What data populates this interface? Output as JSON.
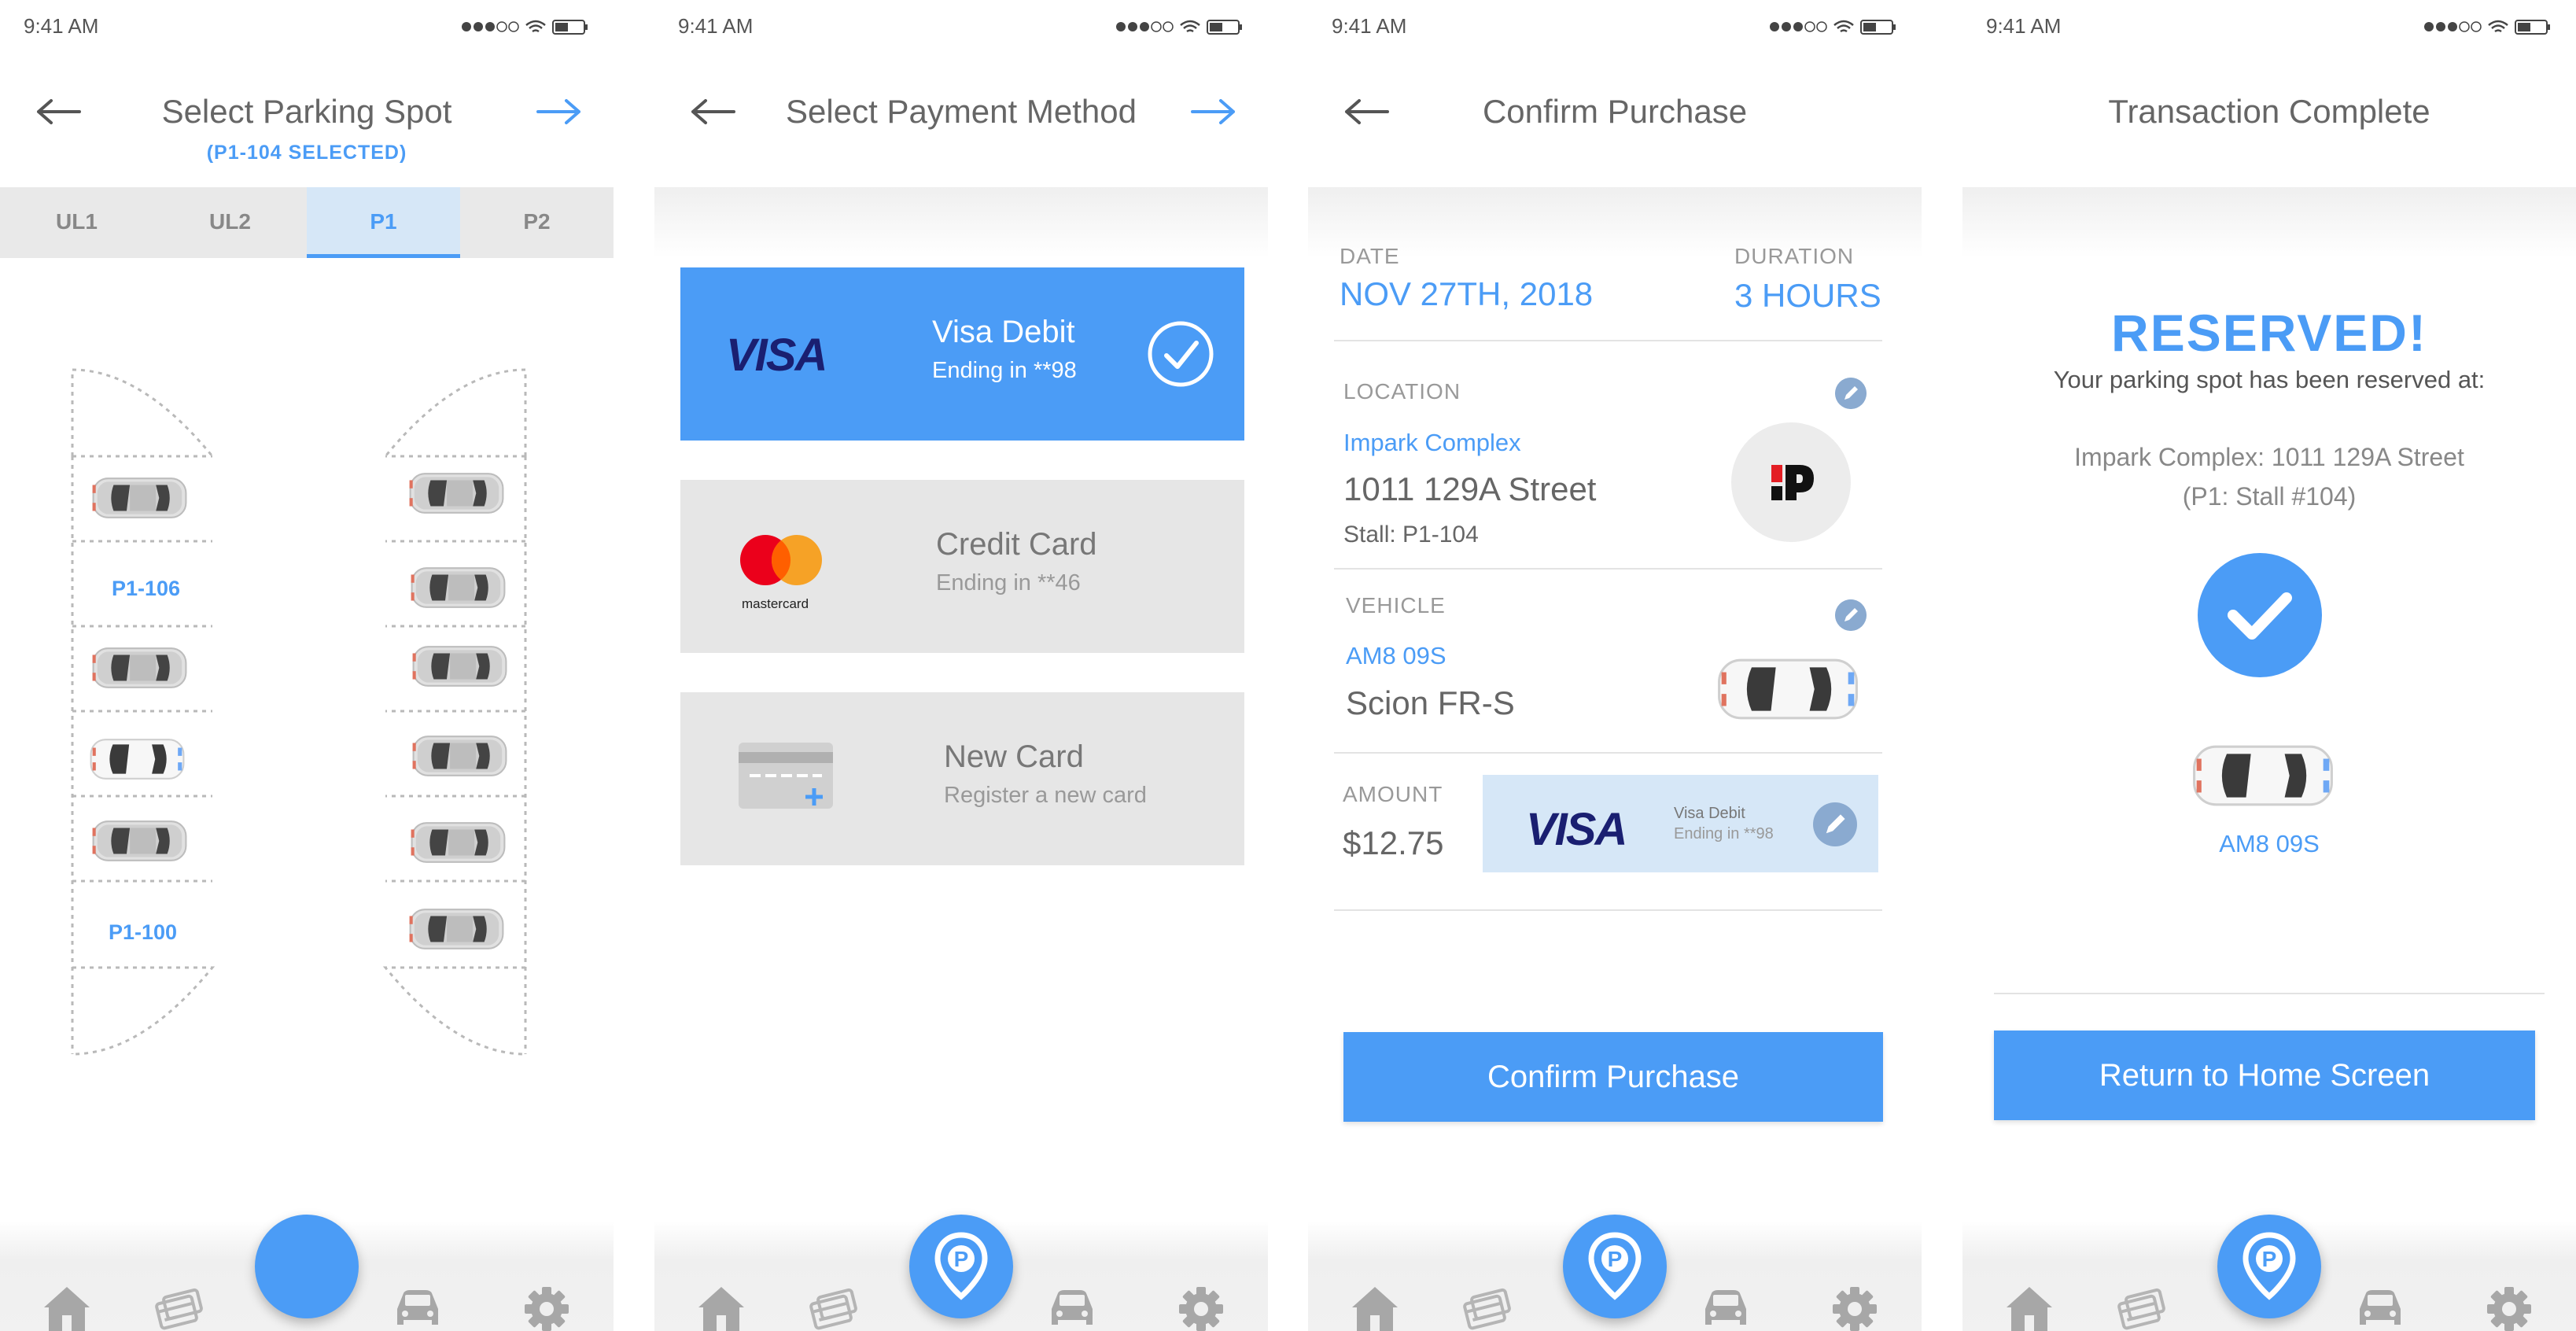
{
  "status_time": "9:41 AM",
  "screens": {
    "spot": {
      "title": "Select Parking Spot",
      "subtitle": "(P1-104 SELECTED)",
      "tabs": [
        "UL1",
        "UL2",
        "P1",
        "P2"
      ],
      "selected_tab": "P1",
      "spot_labels": [
        "P1-106",
        "P1-100"
      ]
    },
    "payment": {
      "title": "Select Payment Method",
      "cards": [
        {
          "name": "Visa Debit",
          "detail": "Ending in **98",
          "selected": true,
          "logo": "visa-logo"
        },
        {
          "name": "Credit Card",
          "detail": "Ending in **46",
          "selected": false,
          "logo": "mastercard-logo"
        },
        {
          "name": "New Card",
          "detail": "Register a new card",
          "selected": false,
          "logo": "new-card-icon"
        }
      ],
      "visa_text": "VISA",
      "mastercard_text": "mastercard"
    },
    "confirm": {
      "title": "Confirm Purchase",
      "date_label": "DATE",
      "date_value": "NOV 27TH, 2018",
      "duration_label": "DURATION",
      "duration_value": "3 HOURS",
      "location_label": "LOCATION",
      "location_name": "Impark Complex",
      "location_street": "1011 129A Street",
      "location_stall": "Stall: P1-104",
      "vehicle_label": "VEHICLE",
      "vehicle_plate": "AM8 09S",
      "vehicle_model": "Scion FR-S",
      "amount_label": "AMOUNT",
      "amount_value": "$12.75",
      "card_brand": "VISA",
      "card_name": "Visa Debit",
      "card_detail": "Ending in **98",
      "button": "Confirm Purchase"
    },
    "complete": {
      "title": "Transaction Complete",
      "heading": "RESERVED!",
      "subheading": "Your parking spot has been reserved at:",
      "address_line1": "Impark Complex: 1011 129A Street",
      "address_line2": "(P1: Stall #104)",
      "plate": "AM8 09S",
      "button": "Return to Home Screen"
    }
  },
  "colors": {
    "accent": "#4b9cf6",
    "card_grey": "#e6e6e6",
    "text_grey": "#666666"
  }
}
